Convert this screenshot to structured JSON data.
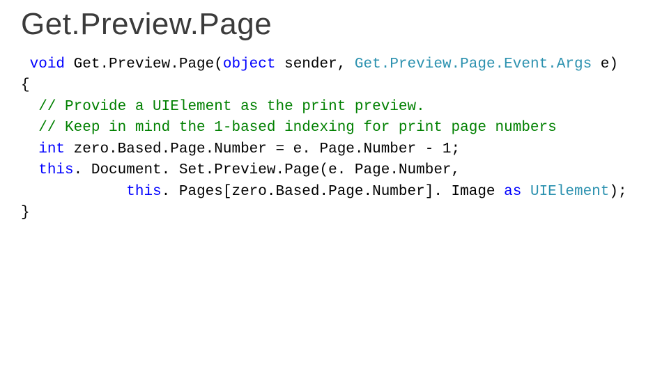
{
  "title": "Get.Preview.Page",
  "code": {
    "l1": {
      "kw_void": "void",
      "method": " Get.Preview.Page(",
      "kw_object": "object",
      "sender": " sender, ",
      "argtype": "Get.Preview.Page.Event.Args",
      "tail": " e)"
    },
    "l2": "{",
    "l3": {
      "lead": "  ",
      "cmt": "// Provide a UIElement as the print preview."
    },
    "l4": {
      "lead": "  ",
      "cmt": "// Keep in mind the 1-based indexing for print page numbers"
    },
    "l5": {
      "lead": "  ",
      "kw_int": "int",
      "rest": " zero.Based.Page.Number = e. Page.Number - 1;"
    },
    "l6": {
      "lead": "  ",
      "kw_this": "this",
      "rest": ". Document. Set.Preview.Page(e. Page.Number,"
    },
    "l7": {
      "lead": "            ",
      "kw_this": "this",
      "mid": ". Pages[zero.Based.Page.Number]. Image ",
      "kw_as": "as",
      "sp": " ",
      "uitype": "UIElement",
      "tail": ");"
    },
    "l8": "}"
  }
}
